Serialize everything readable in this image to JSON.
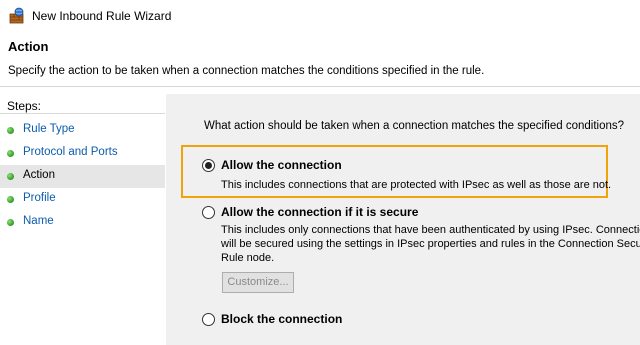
{
  "window": {
    "title": "New Inbound Rule Wizard"
  },
  "header": {
    "title": "Action",
    "description": "Specify the action to be taken when a connection matches the conditions specified in the rule."
  },
  "sidebar": {
    "steps_label": "Steps:",
    "items": [
      {
        "label": "Rule Type"
      },
      {
        "label": "Protocol and Ports"
      },
      {
        "label": "Action"
      },
      {
        "label": "Profile"
      },
      {
        "label": "Name"
      }
    ],
    "selected_index": 2
  },
  "main": {
    "question": "What action should be taken when a connection matches the specified conditions?",
    "options": [
      {
        "label": "Allow the connection",
        "description": [
          "This includes connections that are protected with IPsec as well as those are not."
        ],
        "checked": true
      },
      {
        "label": "Allow the connection if it is secure",
        "description": [
          "This includes only connections that have been authenticated by using IPsec.  Connection",
          "will be secured using the settings in IPsec properties and rules in the Connection Security",
          "Rule node."
        ],
        "checked": false,
        "button_label": "Customize..."
      },
      {
        "label": "Block the connection",
        "checked": false
      }
    ]
  },
  "colors": {
    "highlight": "#f0a30a",
    "link": "#0b5cad",
    "step_dot": "#3da32b"
  },
  "icons": {
    "app": "firewall-wizard-icon",
    "step": "green-dot-icon"
  }
}
